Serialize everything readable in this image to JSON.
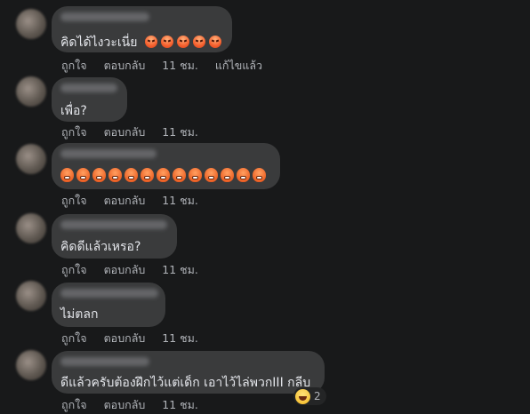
{
  "comments": [
    {
      "text": "คิดได้ไงวะเนี่ย",
      "actions": {
        "like": "ถูกใจ",
        "reply": "ตอบกลับ",
        "time": "11 ชม.",
        "edited": "แก้ไขแล้ว"
      }
    },
    {
      "text": "เพื่อ?",
      "actions": {
        "like": "ถูกใจ",
        "reply": "ตอบกลับ",
        "time": "11 ชม."
      }
    },
    {
      "text": "",
      "actions": {
        "like": "ถูกใจ",
        "reply": "ตอบกลับ",
        "time": "11 ชม."
      }
    },
    {
      "text": "คิดดีแล้วเหรอ?",
      "actions": {
        "like": "ถูกใจ",
        "reply": "ตอบกลับ",
        "time": "11 ชม."
      }
    },
    {
      "text": "ไม่ตลก",
      "actions": {
        "like": "ถูกใจ",
        "reply": "ตอบกลับ",
        "time": "11 ชม."
      }
    },
    {
      "text": "ดีแล้วครับต้องฝึกไว้แต่เด็ก เอาไว้ไล่พวกIII กลีบ",
      "actions": {
        "like": "ถูกใจ",
        "reply": "ตอบกลับ",
        "time": "11 ชม."
      },
      "reaction_count": "2"
    }
  ],
  "icons": {
    "angry": "angry-emoji-icon",
    "pout": "pouting-emoji-icon",
    "laugh": "laughing-emoji-icon"
  },
  "colors": {
    "background": "#18191a",
    "bubble": "#3a3b3c",
    "text": "#e4e6eb",
    "secondary": "#b0b3b8"
  }
}
